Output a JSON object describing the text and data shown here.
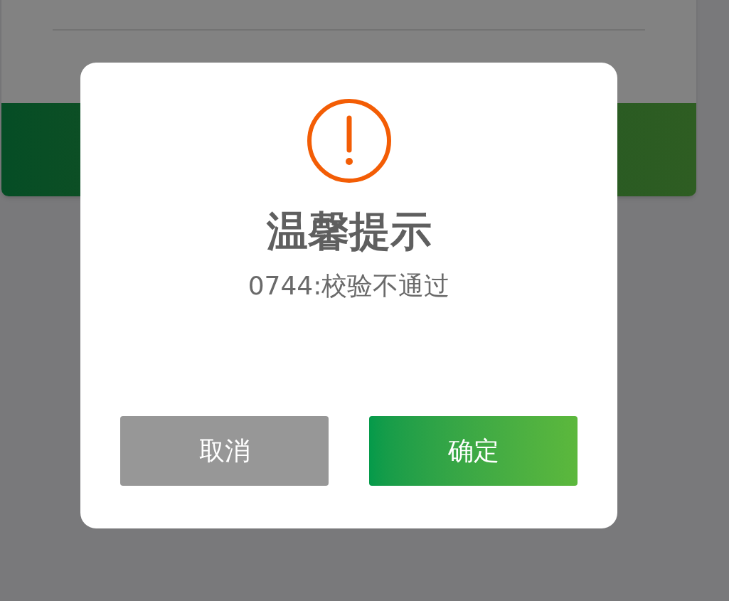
{
  "dialog": {
    "title": "温馨提示",
    "message": "0744:校验不通过",
    "buttons": [
      {
        "label": "取消",
        "kind": "secondary"
      },
      {
        "label": "确定",
        "kind": "primary"
      }
    ]
  }
}
